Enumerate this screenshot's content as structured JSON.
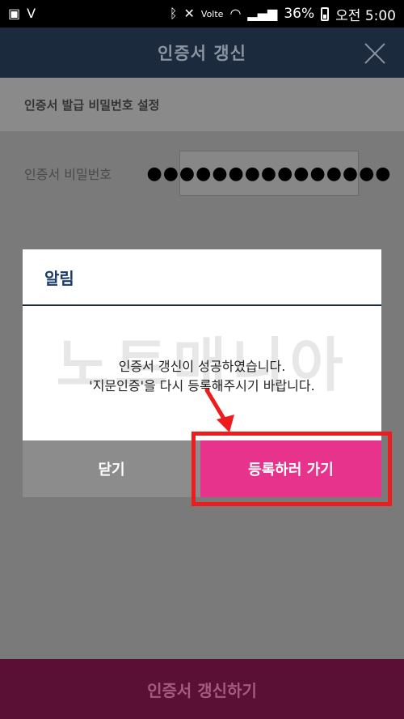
{
  "status_bar": {
    "battery": "36%",
    "time": "오전 5:00",
    "network": "Volte"
  },
  "header": {
    "title": "인증서 갱신"
  },
  "section": {
    "title": "인증서 발급 비밀번호 설정"
  },
  "password": {
    "label": "인증서 비밀번호",
    "value": "●●●●●●●●●●●●●●●"
  },
  "bottom_button": {
    "label": "인증서 갱신하기"
  },
  "dialog": {
    "title": "알림",
    "watermark": "노트매니아",
    "message_line1": "인증서 갱신이 성공하였습니다.",
    "message_line2": "'지문인증'을 다시 등록해주시기 바랍니다.",
    "close_label": "닫기",
    "register_label": "등록하러 가기"
  },
  "colors": {
    "header_bg": "#1b2a3d",
    "accent_pink": "#e8338c",
    "annotation_red": "#ee1c1c"
  }
}
